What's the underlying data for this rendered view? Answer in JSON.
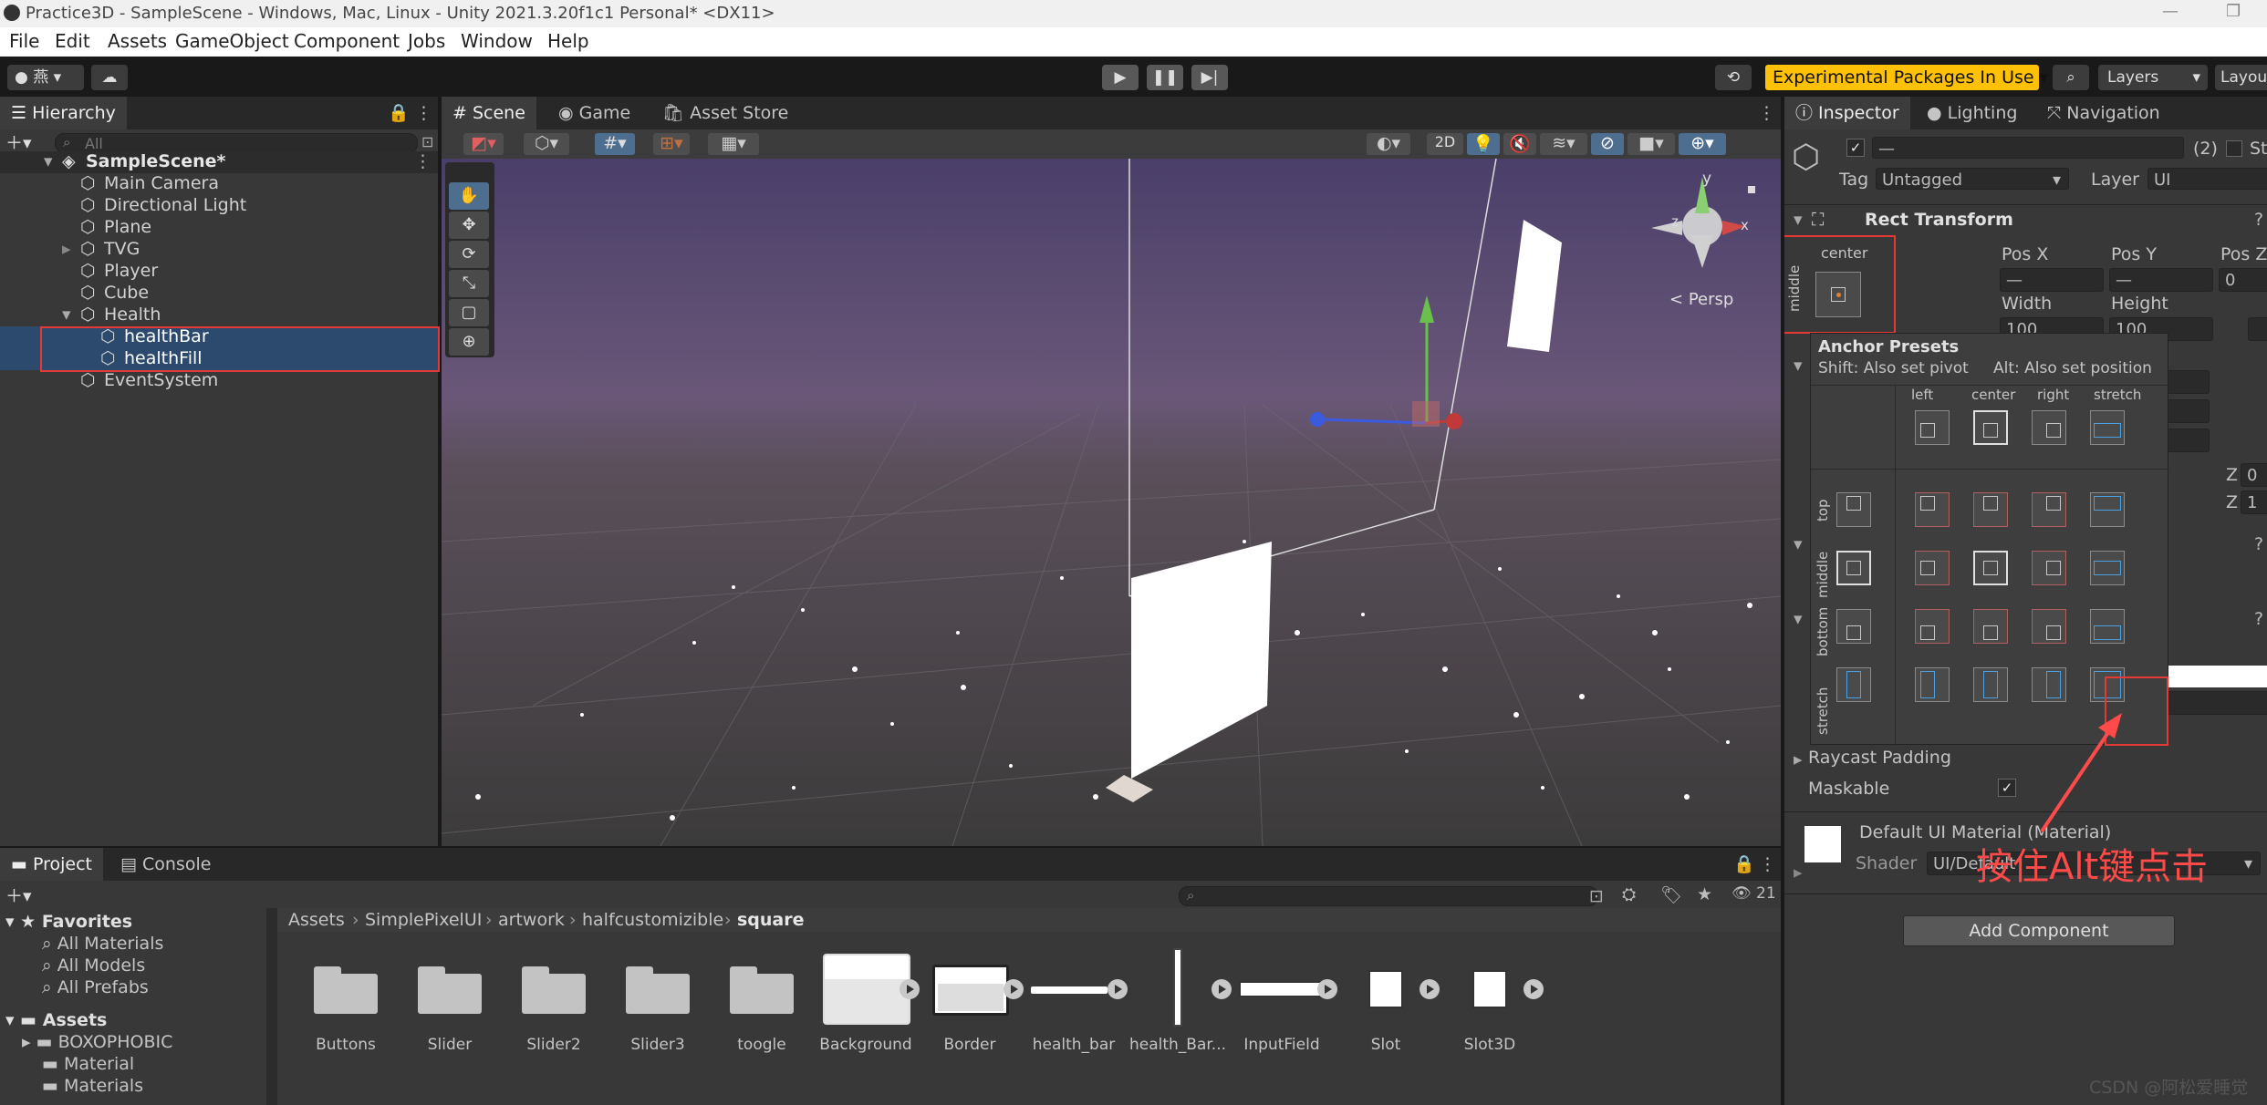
{
  "window": {
    "title": "Practice3D - SampleScene - Windows, Mac, Linux - Unity 2021.3.20f1c1 Personal* <DX11>"
  },
  "menu": [
    "File",
    "Edit",
    "Assets",
    "GameObject",
    "Component",
    "Jobs",
    "Window",
    "Help"
  ],
  "toolbar": {
    "account": "燕",
    "experimental": "Experimental Packages In Use",
    "layers": "Layers",
    "layout": "Layou"
  },
  "hierarchy": {
    "tab": "Hierarchy",
    "search_placeholder": "All",
    "scene": "SampleScene*",
    "items": [
      "Main Camera",
      "Directional Light",
      "Plane",
      "TVG",
      "Player",
      "Cube",
      "Health",
      "healthBar",
      "healthFill",
      "EventSystem"
    ]
  },
  "scene_tabs": [
    "Scene",
    "Game",
    "Asset Store"
  ],
  "scene_view": {
    "mode_2d": "2D",
    "persp": "Persp",
    "gizmo_x": "x",
    "gizmo_y": "y",
    "gizmo_z": "z"
  },
  "inspector": {
    "tabs": [
      "Inspector",
      "Lighting",
      "Navigation"
    ],
    "object_count": "(2)",
    "static": "St",
    "name_value": "—",
    "tag_label": "Tag",
    "tag_value": "Untagged",
    "layer_label": "Layer",
    "layer_value": "UI",
    "rect_transform": "Rect Transform",
    "anchor_h": "center",
    "anchor_v": "middle",
    "pos_x": "Pos X",
    "pos_y": "Pos Y",
    "pos_z": "Pos Z",
    "pos_x_val": "—",
    "pos_y_val": "—",
    "pos_z_val": "0",
    "width": "Width",
    "height": "Height",
    "width_val": "100",
    "height_val": "100",
    "z_label": "Z",
    "z1": "0",
    "z2": "1",
    "raycast_padding": "Raycast Padding",
    "maskable": "Maskable",
    "material_name": "Default UI Material (Material)",
    "shader_label": "Shader",
    "shader_value": "UI/Default",
    "add_component": "Add Component",
    "annotation": "按住Alt键点击"
  },
  "anchor_presets": {
    "title": "Anchor Presets",
    "hint1": "Shift: Also set pivot",
    "hint2": "Alt: Also set position",
    "cols": [
      "left",
      "center",
      "right",
      "stretch"
    ],
    "rows": [
      "top",
      "middle",
      "bottom",
      "stretch"
    ]
  },
  "bottom": {
    "tabs": [
      "Project",
      "Console"
    ],
    "hidden_count": "21",
    "favorites": "Favorites",
    "fav_items": [
      "All Materials",
      "All Models",
      "All Prefabs"
    ],
    "assets": "Assets",
    "asset_folders": [
      "BOXOPHOBIC",
      "Material",
      "Materials"
    ],
    "breadcrumb": [
      "Assets",
      "SimplePixelUI",
      "artwork",
      "halfcustomizible",
      "square"
    ],
    "items": [
      "Buttons",
      "Slider",
      "Slider2",
      "Slider3",
      "toogle",
      "Background",
      "Border",
      "health_bar",
      "health_Bar...",
      "InputField",
      "Slot",
      "Slot3D"
    ]
  },
  "watermark": "CSDN @阿松爱睡觉"
}
